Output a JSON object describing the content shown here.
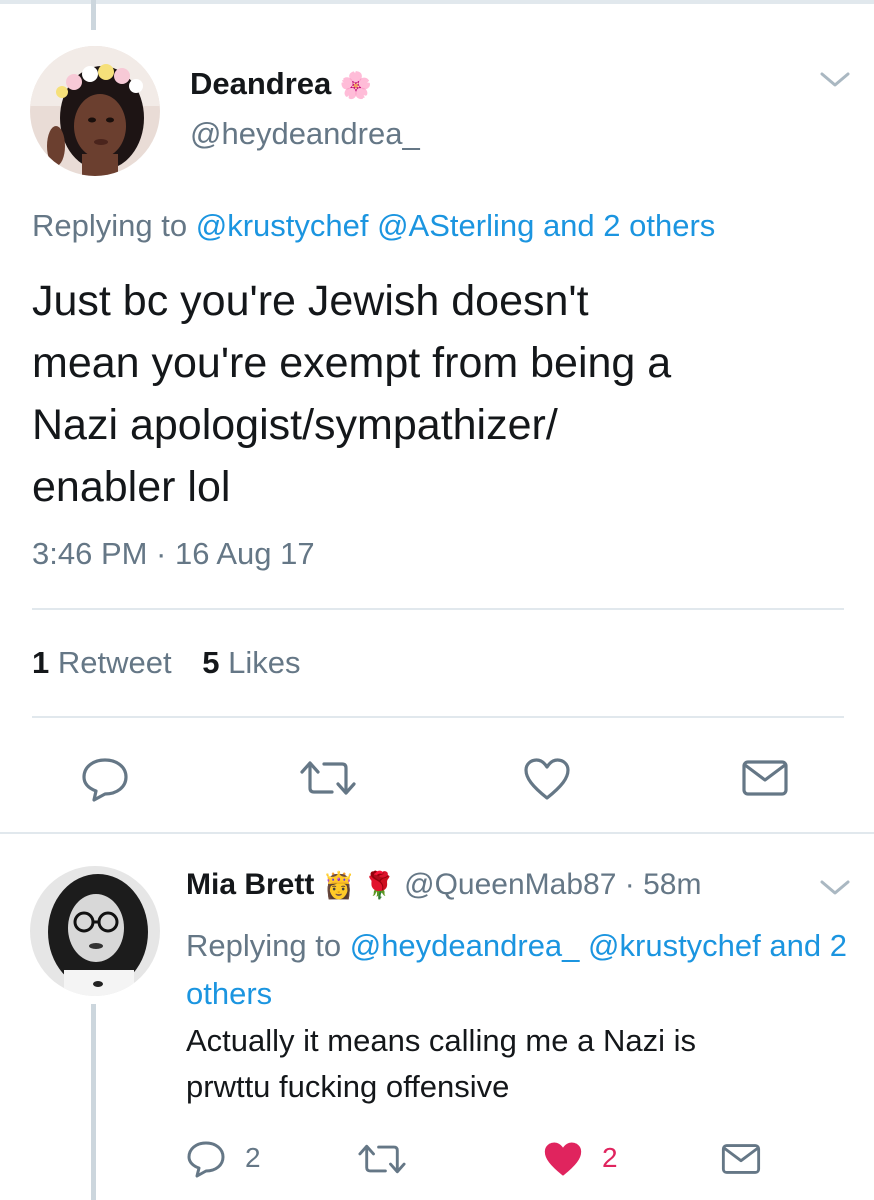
{
  "main_tweet": {
    "display_name": "Deandrea",
    "name_emoji": "🌸",
    "handle": "@heydeandrea_",
    "replying_prefix": "Replying to",
    "replying_mentions": "@krustychef @ASterling and 2 others",
    "text": "Just bc you're Jewish doesn't\nmean you're exempt from being a\nNazi apologist/sympathizer/\nenabler lol",
    "timestamp": "3:46 PM · 16 Aug 17",
    "retweets_count": "1",
    "retweets_label": "Retweet",
    "likes_count": "5",
    "likes_label": "Likes"
  },
  "reply_tweet": {
    "display_name": "Mia Brett",
    "name_emoji": "👸",
    "name_emoji_2": "🌹",
    "handle": "@QueenMab87",
    "time_ago": "· 58m",
    "replying_prefix": "Replying to",
    "replying_mentions": "@heydeandrea_ @krustychef and 2 others",
    "text": "Actually it means calling me a Nazi is\nprwttu fucking offensive",
    "reply_count": "2",
    "like_count": "2"
  },
  "icons": {
    "actions": [
      "reply-icon",
      "retweet-icon",
      "like-icon",
      "direct-message-icon"
    ],
    "menu": "chevron-down-icon"
  },
  "colors": {
    "link": "#1b95e0",
    "secondary_text": "#657786",
    "icon_gray": "#657786",
    "like_red": "#e0245e"
  }
}
